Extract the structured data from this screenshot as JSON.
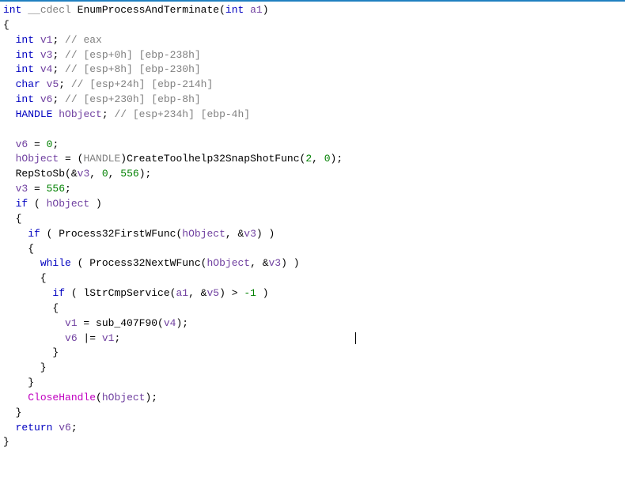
{
  "code": {
    "signature": {
      "ret_type": "int",
      "call_conv": "__cdecl",
      "func_name": "EnumProcessAndTerminate",
      "param_type": "int",
      "param_name": "a1"
    },
    "decls": [
      {
        "type": "int",
        "name": "v1",
        "comment": "// eax"
      },
      {
        "type": "int",
        "name": "v3",
        "comment": "// [esp+0h] [ebp-238h]"
      },
      {
        "type": "int",
        "name": "v4",
        "comment": "// [esp+8h] [ebp-230h]"
      },
      {
        "type": "char",
        "name": "v5",
        "comment": "// [esp+24h] [ebp-214h]"
      },
      {
        "type": "int",
        "name": "v6",
        "comment": "// [esp+230h] [ebp-8h]"
      },
      {
        "type": "HANDLE",
        "name": "hObject",
        "comment": "// [esp+234h] [ebp-4h]"
      }
    ],
    "body": {
      "v6_init": "0",
      "hObject_assign": {
        "cast": "HANDLE",
        "func": "CreateToolhelp32SnapShotFunc",
        "args": [
          "2",
          "0"
        ]
      },
      "repstosb": {
        "func": "RepStoSb",
        "arg1": "v3",
        "arg2": "0",
        "arg3": "556"
      },
      "v3_assign": "556",
      "if_cond": "hObject",
      "process32first": {
        "func": "Process32FirstWFunc",
        "arg1": "hObject",
        "arg2": "v3"
      },
      "process32next": {
        "func": "Process32NextWFunc",
        "arg1": "hObject",
        "arg2": "v3"
      },
      "lstrcmp": {
        "func": "lStrCmpService",
        "arg1": "a1",
        "arg2": "v5",
        "cmp": "-1"
      },
      "v1_assign": {
        "func": "sub_407F90",
        "arg": "v4"
      },
      "v6_or": "v1",
      "closehandle": {
        "func": "CloseHandle",
        "arg": "hObject"
      },
      "return_var": "v6"
    }
  }
}
